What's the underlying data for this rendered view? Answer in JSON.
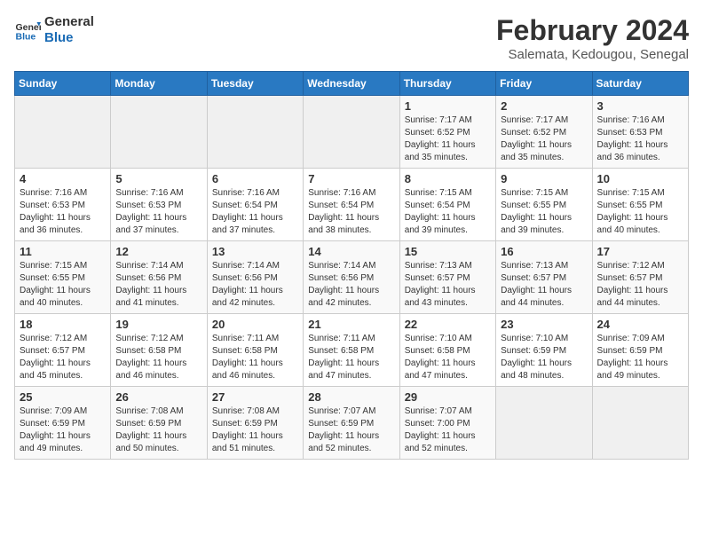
{
  "header": {
    "logo_line1": "General",
    "logo_line2": "Blue",
    "title": "February 2024",
    "subtitle": "Salemata, Kedougou, Senegal"
  },
  "calendar": {
    "days_of_week": [
      "Sunday",
      "Monday",
      "Tuesday",
      "Wednesday",
      "Thursday",
      "Friday",
      "Saturday"
    ],
    "weeks": [
      [
        {
          "day": "",
          "info": ""
        },
        {
          "day": "",
          "info": ""
        },
        {
          "day": "",
          "info": ""
        },
        {
          "day": "",
          "info": ""
        },
        {
          "day": "1",
          "info": "Sunrise: 7:17 AM\nSunset: 6:52 PM\nDaylight: 11 hours and 35 minutes."
        },
        {
          "day": "2",
          "info": "Sunrise: 7:17 AM\nSunset: 6:52 PM\nDaylight: 11 hours and 35 minutes."
        },
        {
          "day": "3",
          "info": "Sunrise: 7:16 AM\nSunset: 6:53 PM\nDaylight: 11 hours and 36 minutes."
        }
      ],
      [
        {
          "day": "4",
          "info": "Sunrise: 7:16 AM\nSunset: 6:53 PM\nDaylight: 11 hours and 36 minutes."
        },
        {
          "day": "5",
          "info": "Sunrise: 7:16 AM\nSunset: 6:53 PM\nDaylight: 11 hours and 37 minutes."
        },
        {
          "day": "6",
          "info": "Sunrise: 7:16 AM\nSunset: 6:54 PM\nDaylight: 11 hours and 37 minutes."
        },
        {
          "day": "7",
          "info": "Sunrise: 7:16 AM\nSunset: 6:54 PM\nDaylight: 11 hours and 38 minutes."
        },
        {
          "day": "8",
          "info": "Sunrise: 7:15 AM\nSunset: 6:54 PM\nDaylight: 11 hours and 39 minutes."
        },
        {
          "day": "9",
          "info": "Sunrise: 7:15 AM\nSunset: 6:55 PM\nDaylight: 11 hours and 39 minutes."
        },
        {
          "day": "10",
          "info": "Sunrise: 7:15 AM\nSunset: 6:55 PM\nDaylight: 11 hours and 40 minutes."
        }
      ],
      [
        {
          "day": "11",
          "info": "Sunrise: 7:15 AM\nSunset: 6:55 PM\nDaylight: 11 hours and 40 minutes."
        },
        {
          "day": "12",
          "info": "Sunrise: 7:14 AM\nSunset: 6:56 PM\nDaylight: 11 hours and 41 minutes."
        },
        {
          "day": "13",
          "info": "Sunrise: 7:14 AM\nSunset: 6:56 PM\nDaylight: 11 hours and 42 minutes."
        },
        {
          "day": "14",
          "info": "Sunrise: 7:14 AM\nSunset: 6:56 PM\nDaylight: 11 hours and 42 minutes."
        },
        {
          "day": "15",
          "info": "Sunrise: 7:13 AM\nSunset: 6:57 PM\nDaylight: 11 hours and 43 minutes."
        },
        {
          "day": "16",
          "info": "Sunrise: 7:13 AM\nSunset: 6:57 PM\nDaylight: 11 hours and 44 minutes."
        },
        {
          "day": "17",
          "info": "Sunrise: 7:12 AM\nSunset: 6:57 PM\nDaylight: 11 hours and 44 minutes."
        }
      ],
      [
        {
          "day": "18",
          "info": "Sunrise: 7:12 AM\nSunset: 6:57 PM\nDaylight: 11 hours and 45 minutes."
        },
        {
          "day": "19",
          "info": "Sunrise: 7:12 AM\nSunset: 6:58 PM\nDaylight: 11 hours and 46 minutes."
        },
        {
          "day": "20",
          "info": "Sunrise: 7:11 AM\nSunset: 6:58 PM\nDaylight: 11 hours and 46 minutes."
        },
        {
          "day": "21",
          "info": "Sunrise: 7:11 AM\nSunset: 6:58 PM\nDaylight: 11 hours and 47 minutes."
        },
        {
          "day": "22",
          "info": "Sunrise: 7:10 AM\nSunset: 6:58 PM\nDaylight: 11 hours and 47 minutes."
        },
        {
          "day": "23",
          "info": "Sunrise: 7:10 AM\nSunset: 6:59 PM\nDaylight: 11 hours and 48 minutes."
        },
        {
          "day": "24",
          "info": "Sunrise: 7:09 AM\nSunset: 6:59 PM\nDaylight: 11 hours and 49 minutes."
        }
      ],
      [
        {
          "day": "25",
          "info": "Sunrise: 7:09 AM\nSunset: 6:59 PM\nDaylight: 11 hours and 49 minutes."
        },
        {
          "day": "26",
          "info": "Sunrise: 7:08 AM\nSunset: 6:59 PM\nDaylight: 11 hours and 50 minutes."
        },
        {
          "day": "27",
          "info": "Sunrise: 7:08 AM\nSunset: 6:59 PM\nDaylight: 11 hours and 51 minutes."
        },
        {
          "day": "28",
          "info": "Sunrise: 7:07 AM\nSunset: 6:59 PM\nDaylight: 11 hours and 52 minutes."
        },
        {
          "day": "29",
          "info": "Sunrise: 7:07 AM\nSunset: 7:00 PM\nDaylight: 11 hours and 52 minutes."
        },
        {
          "day": "",
          "info": ""
        },
        {
          "day": "",
          "info": ""
        }
      ]
    ]
  }
}
